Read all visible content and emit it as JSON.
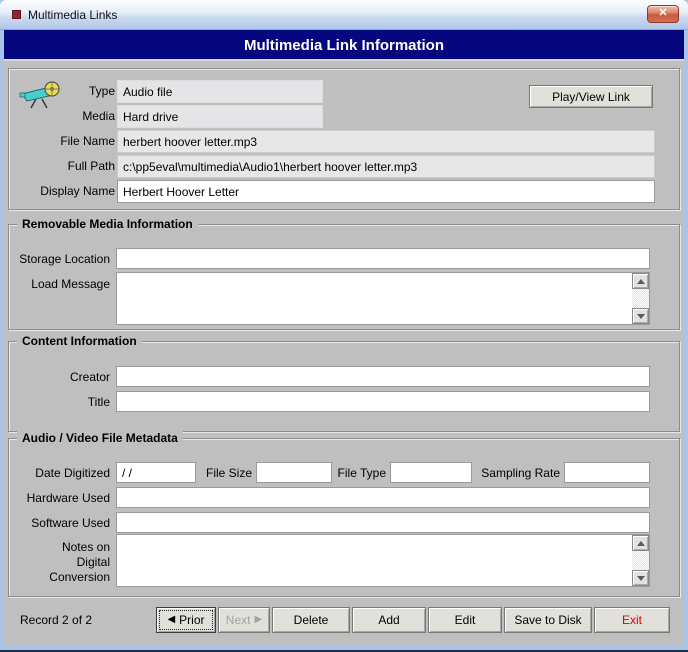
{
  "window": {
    "title": "Multimedia Links",
    "close_glyph": "✕"
  },
  "header": {
    "title": "Multimedia Link Information"
  },
  "link_info": {
    "play_button": "Play/View Link",
    "type": {
      "label": "Type",
      "value": "Audio file"
    },
    "media": {
      "label": "Media",
      "value": "Hard drive"
    },
    "file_name": {
      "label": "File Name",
      "value": "herbert hoover letter.mp3"
    },
    "full_path": {
      "label": "Full Path",
      "value": "c:\\pp5eval\\multimedia\\Audio1\\herbert hoover letter.mp3"
    },
    "display_name": {
      "label": "Display Name",
      "value": "Herbert Hoover Letter"
    }
  },
  "removable_media": {
    "title": "Removable Media Information",
    "storage_location": {
      "label": "Storage Location",
      "value": ""
    },
    "load_message": {
      "label": "Load Message",
      "value": ""
    }
  },
  "content_info": {
    "title": "Content Information",
    "creator": {
      "label": "Creator",
      "value": ""
    },
    "title_field": {
      "label": "Title",
      "value": ""
    }
  },
  "metadata": {
    "title": "Audio / Video File Metadata",
    "date_digitized": {
      "label": "Date Digitized",
      "value": "/ /"
    },
    "file_size": {
      "label": "File Size",
      "value": ""
    },
    "file_type": {
      "label": "File Type",
      "value": ""
    },
    "sampling_rate": {
      "label": "Sampling Rate",
      "value": ""
    },
    "hardware_used": {
      "label": "Hardware Used",
      "value": ""
    },
    "software_used": {
      "label": "Software Used",
      "value": ""
    },
    "notes": {
      "label": "Notes on Digital Conversion",
      "value": ""
    }
  },
  "footer": {
    "record_status": "Record 2 of 2",
    "prior": {
      "icon": "◀",
      "label": "Prior"
    },
    "next": {
      "label": "Next",
      "icon": "▶"
    },
    "delete_label": "Delete",
    "add_label": "Add",
    "edit_label": "Edit",
    "save_label": "Save to Disk",
    "exit_label": "Exit"
  },
  "colors": {
    "accent_navy": "#06067F",
    "frame_blue": "#A9C4E6",
    "body_gray": "#BFBFBF",
    "exit_red": "#E00000",
    "close_red": "#C65B40"
  }
}
